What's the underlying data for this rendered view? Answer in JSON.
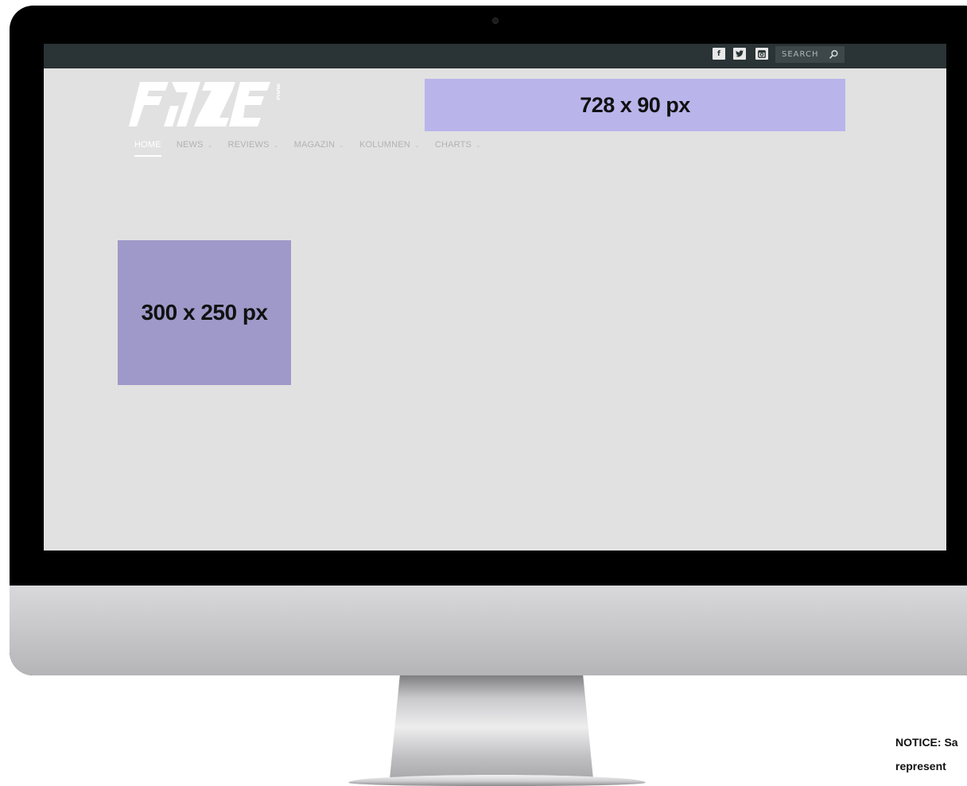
{
  "topbar": {
    "social": [
      {
        "name": "facebook",
        "glyph": "f"
      },
      {
        "name": "twitter",
        "glyph": "♥"
      },
      {
        "name": "instagram",
        "glyph": "▣"
      }
    ],
    "search_label": "SEARCH"
  },
  "logo": {
    "brand": "FAZE",
    "suffix": "MAG"
  },
  "ads": {
    "leaderboard_label": "728 x 90 px",
    "rectangle_label": "300 x 250 px"
  },
  "nav": {
    "items": [
      {
        "label": "HOME",
        "active": true,
        "dropdown": false
      },
      {
        "label": "NEWS",
        "active": false,
        "dropdown": true
      },
      {
        "label": "REVIEWS",
        "active": false,
        "dropdown": true
      },
      {
        "label": "MAGAZIN",
        "active": false,
        "dropdown": true
      },
      {
        "label": "KOLUMNEN",
        "active": false,
        "dropdown": true
      },
      {
        "label": "CHARTS",
        "active": false,
        "dropdown": true
      }
    ],
    "chevron": "⌄"
  },
  "notice": {
    "line1": "NOTICE: Sa",
    "line2": "represent"
  },
  "colors": {
    "topbar": "#2a3335",
    "screen_bg": "#e1e1e1",
    "leaderboard_ad": "#b9b5eb",
    "rectangle_ad": "#9e99c9"
  }
}
